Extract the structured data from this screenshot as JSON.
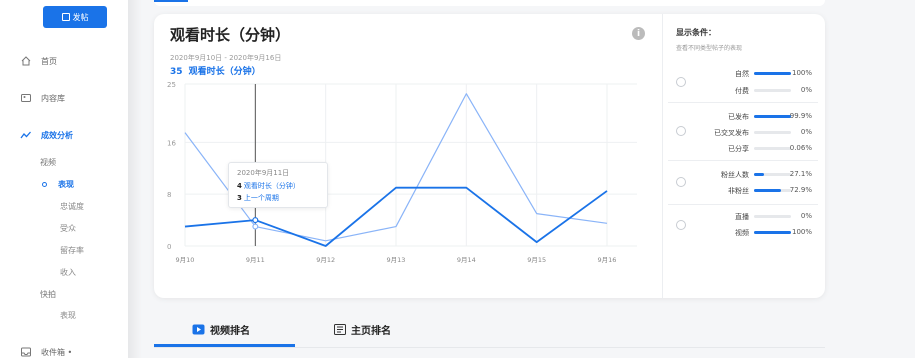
{
  "sidebar": {
    "publish_label": "发帖",
    "nav": [
      {
        "label": "首页"
      },
      {
        "label": "内容库"
      },
      {
        "label": "成效分析"
      }
    ],
    "subnav": {
      "group_video": "视频",
      "performance": "表现",
      "loyalty": "忠诚度",
      "audience": "受众",
      "retention": "留存率",
      "revenue": "收入",
      "group_shorts": "快拍",
      "shorts_performance": "表现"
    },
    "inbox_label": "收件箱 •"
  },
  "card": {
    "title": "观看时长（分钟）",
    "date_range": "2020年9月10日 - 2020年9月16日",
    "total_value": "35",
    "total_label": "观看时长（分钟）",
    "info_icon": "i"
  },
  "tooltip": {
    "date": "2020年9月11日",
    "current_value": "4",
    "current_label": "观看时长（分钟）",
    "previous_value": "3",
    "previous_label": "上一个周期"
  },
  "filters": {
    "title": "显示条件：",
    "subtitle": "查看不同类型帖子的表现",
    "groups": [
      {
        "rows": [
          {
            "label": "自然",
            "pct": "100%",
            "value": 1.0
          },
          {
            "label": "付费",
            "pct": "0%",
            "value": 0.0
          }
        ]
      },
      {
        "rows": [
          {
            "label": "已发布",
            "pct": "99.9%",
            "value": 0.999
          },
          {
            "label": "已交叉发布",
            "pct": "0%",
            "value": 0.0
          },
          {
            "label": "已分享",
            "pct": "0.06%",
            "value": 0.0006
          }
        ]
      },
      {
        "rows": [
          {
            "label": "粉丝人数",
            "pct": "27.1%",
            "value": 0.271
          },
          {
            "label": "非粉丝",
            "pct": "72.9%",
            "value": 0.729
          }
        ]
      },
      {
        "rows": [
          {
            "label": "直播",
            "pct": "0%",
            "value": 0.0
          },
          {
            "label": "视频",
            "pct": "100%",
            "value": 1.0
          }
        ]
      }
    ]
  },
  "tabs": [
    {
      "label": "视频排名",
      "icon": "play-icon"
    },
    {
      "label": "主页排名",
      "icon": "page-icon"
    }
  ],
  "colors": {
    "accent": "#1a73e8",
    "previous": "#8ab4f8"
  },
  "chart_data": {
    "type": "line",
    "title": "",
    "categories": [
      "9月10",
      "9月11",
      "9月12",
      "9月13",
      "9月14",
      "9月15",
      "9月16"
    ],
    "y_ticks": [
      "0",
      "8",
      "16",
      "25"
    ],
    "ylim": [
      0,
      25
    ],
    "grid": true,
    "series": [
      {
        "name": "观看时长（分钟）",
        "values": [
          3,
          4,
          0,
          9,
          9,
          0.6,
          8.5
        ]
      },
      {
        "name": "上一个周期",
        "values": [
          17.5,
          3,
          0.8,
          3,
          23.5,
          5,
          3.5
        ]
      }
    ]
  }
}
